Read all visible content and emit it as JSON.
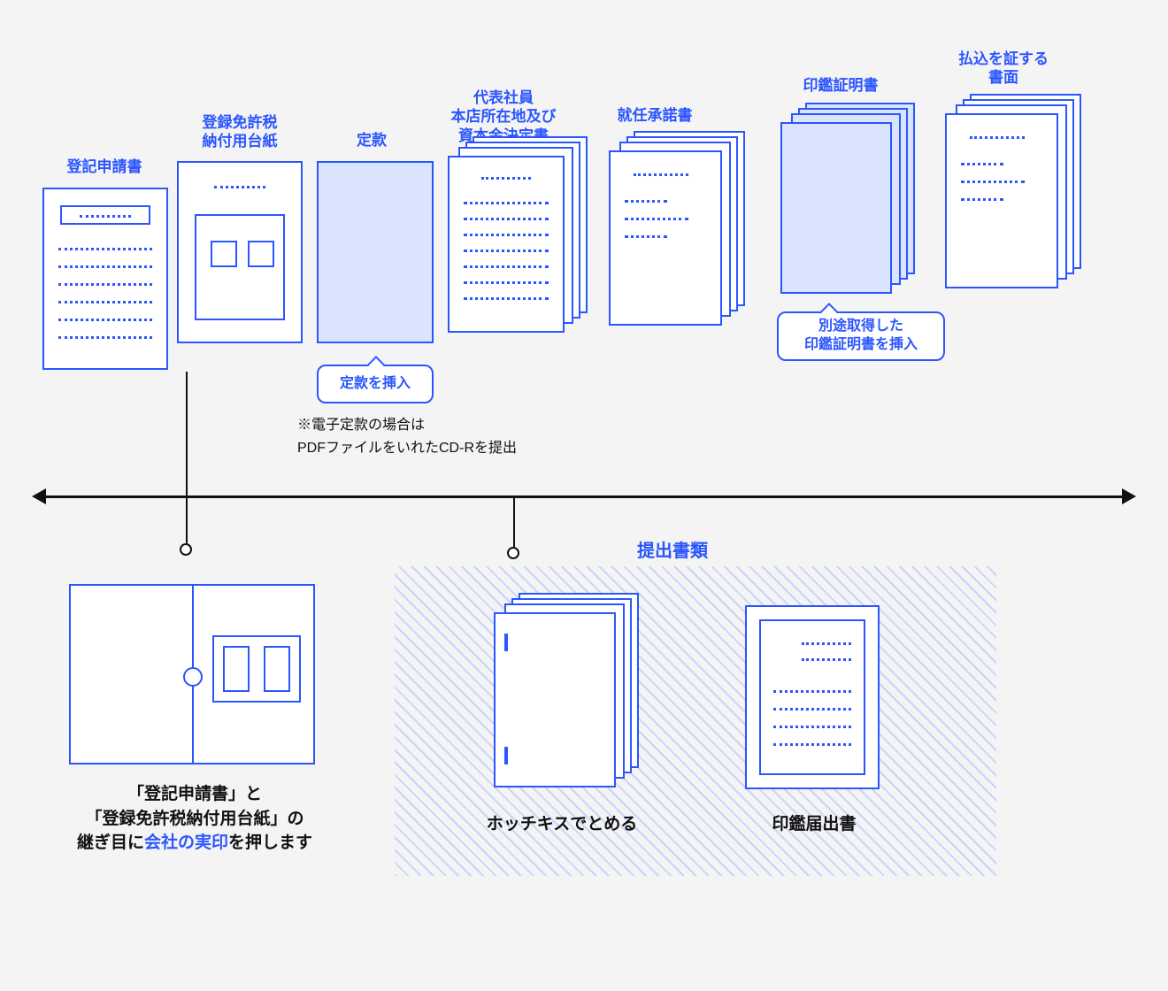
{
  "documents": {
    "registration_application": "登記申請書",
    "tax_payment_mount": "登録免許税\n納付用台紙",
    "articles_of_incorporation": "定款",
    "representative_and_capital": "代表社員\n本店所在地及び\n資本金決定書",
    "acceptance_of_office": "就任承諾書",
    "seal_certificate": "印鑑証明書",
    "proof_of_payment": "払込を証する\n書面"
  },
  "callouts": {
    "insert_articles": "定款を挿入",
    "insert_seal_cert": "別途取得した\n印鑑証明書を挿入"
  },
  "note_electronic_articles": "※電子定款の場合は\nPDFファイルをいれたCD-Rを提出",
  "lower": {
    "submission_docs_title": "提出書類",
    "booklet_caption_prefix": "「登記申請書」と\n「登録免許税納付用台紙」の\n継ぎ目に",
    "booklet_caption_accent": "会社の実印",
    "booklet_caption_suffix": "を押します",
    "staple_caption": "ホッチキスでとめる",
    "seal_registration_caption": "印鑑届出書"
  }
}
